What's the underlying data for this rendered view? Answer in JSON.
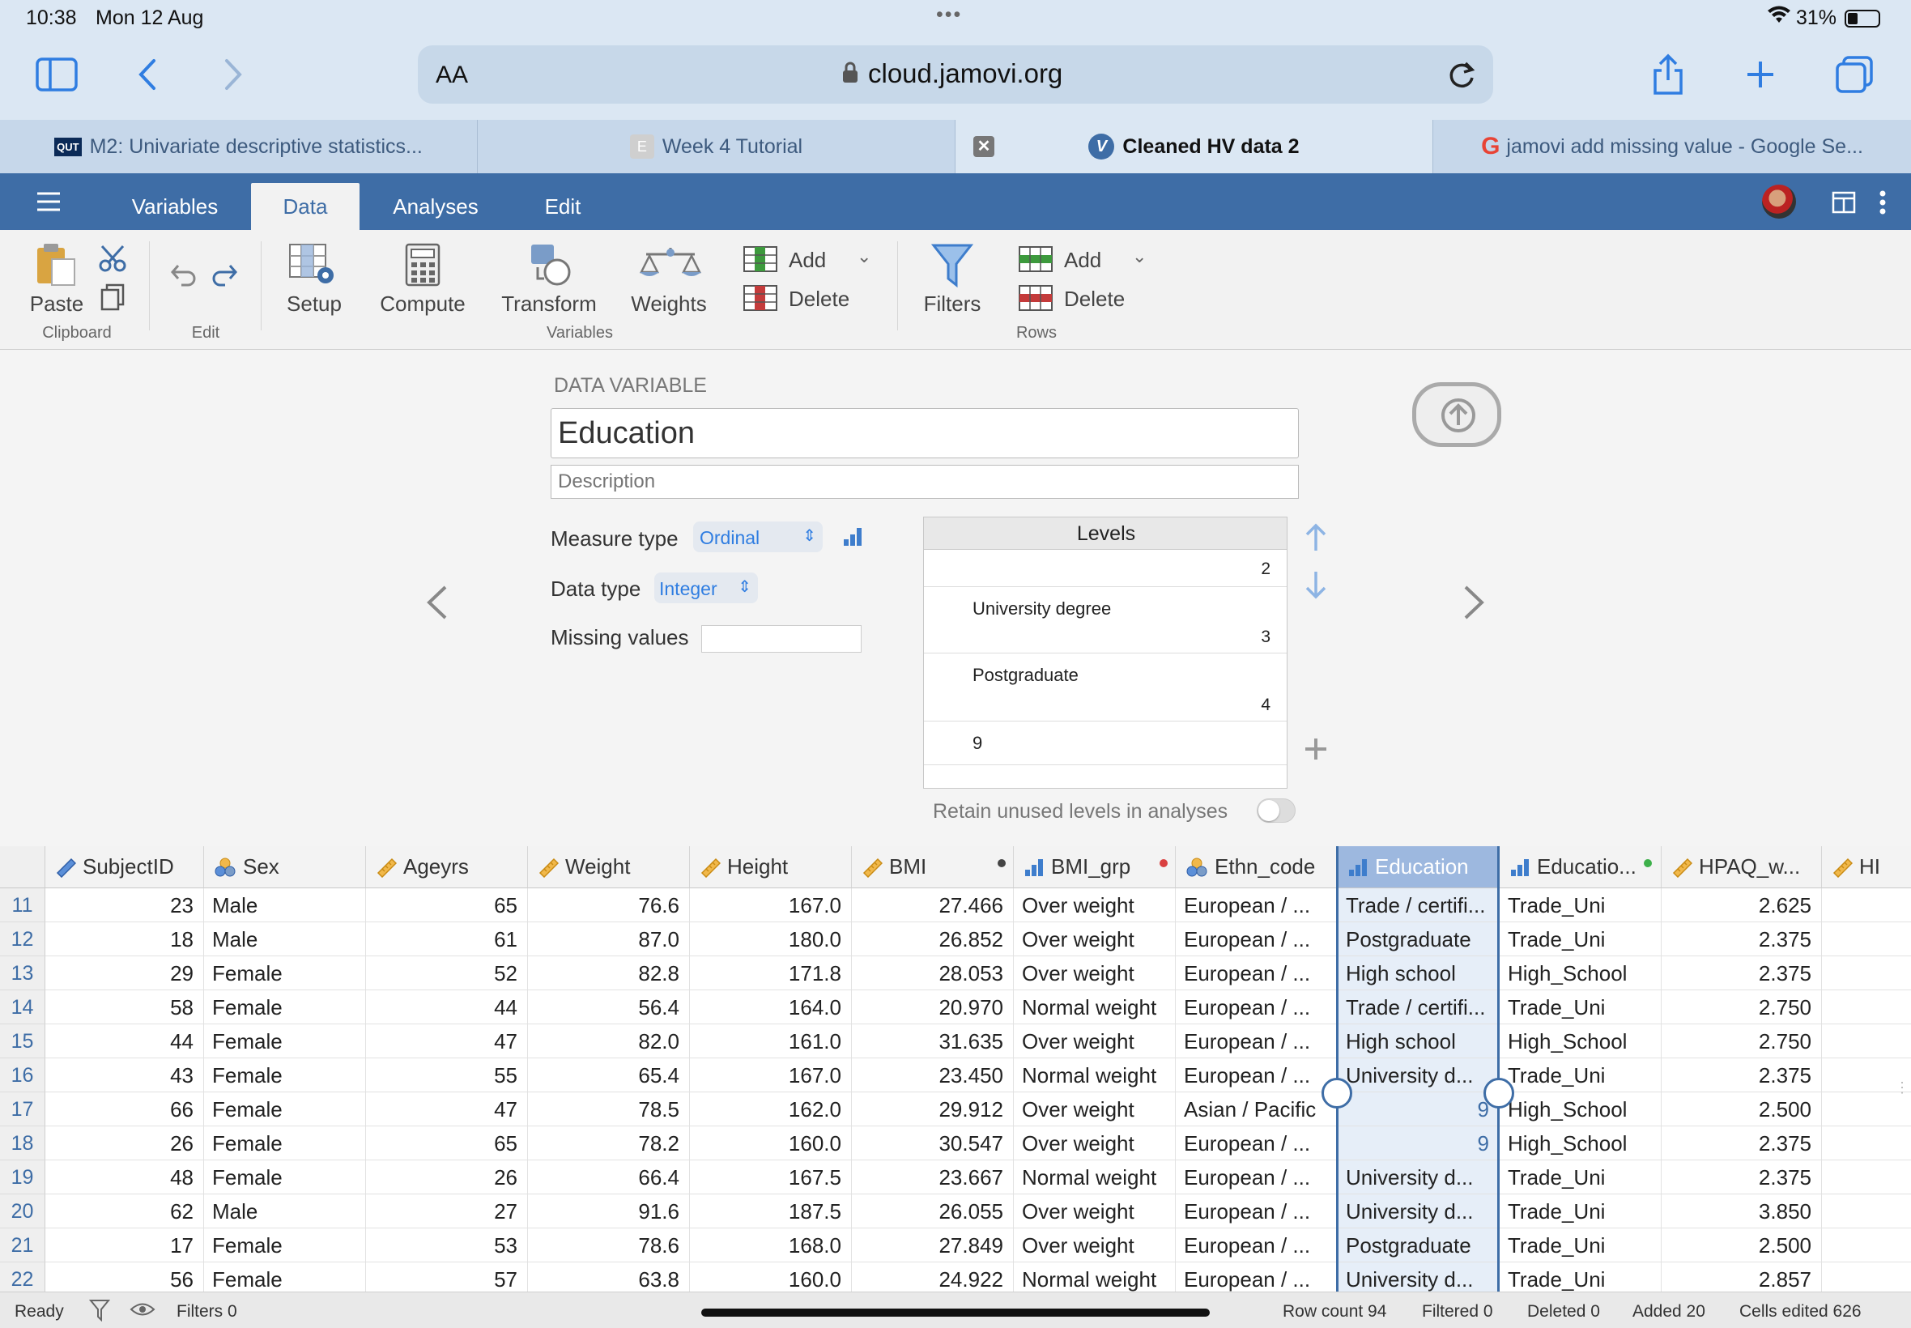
{
  "status": {
    "time": "10:38",
    "date": "Mon 12 Aug",
    "battery": "31%"
  },
  "browser": {
    "aa": "AA",
    "url": "cloud.jamovi.org",
    "tabs": [
      {
        "label": "M2: Univariate descriptive statistics...",
        "icon": "QUT"
      },
      {
        "label": "Week 4 Tutorial",
        "icon": "E"
      },
      {
        "label": "Cleaned HV data 2",
        "icon": "V"
      },
      {
        "label": "jamovi add missing value - Google Se...",
        "icon": "G"
      }
    ]
  },
  "menu": {
    "tabs": [
      "Variables",
      "Data",
      "Analyses",
      "Edit"
    ]
  },
  "ribbon": {
    "paste": "Paste",
    "clipboard": "Clipboard",
    "edit": "Edit",
    "setup": "Setup",
    "compute": "Compute",
    "transform": "Transform",
    "weights": "Weights",
    "add": "Add",
    "delete": "Delete",
    "variables": "Variables",
    "filters": "Filters",
    "rows": "Rows"
  },
  "setup": {
    "section_title": "DATA VARIABLE",
    "var_name": "Education",
    "description_placeholder": "Description",
    "measure_label": "Measure type",
    "measure_value": "Ordinal",
    "dtype_label": "Data type",
    "dtype_value": "Integer",
    "missing_label": "Missing values",
    "levels_header": "Levels",
    "levels": [
      {
        "label": "",
        "value": "2"
      },
      {
        "label": "University degree",
        "value": "3"
      },
      {
        "label": "Postgraduate",
        "value": "4"
      },
      {
        "label": "9",
        "value": ""
      }
    ],
    "retain_label": "Retain unused levels in analyses"
  },
  "grid": {
    "columns": [
      {
        "name": "SubjectID",
        "icon": "ruler-blue"
      },
      {
        "name": "Sex",
        "icon": "nominal"
      },
      {
        "name": "Ageyrs",
        "icon": "ruler"
      },
      {
        "name": "Weight",
        "icon": "ruler"
      },
      {
        "name": "Height",
        "icon": "ruler"
      },
      {
        "name": "BMI",
        "icon": "ruler"
      },
      {
        "name": "BMI_grp",
        "icon": "ordinal"
      },
      {
        "name": "Ethn_code",
        "icon": "nominal"
      },
      {
        "name": "Education",
        "icon": "ordinal"
      },
      {
        "name": "Educatio...",
        "icon": "ordinal"
      },
      {
        "name": "HPAQ_w...",
        "icon": "ruler"
      },
      {
        "name": "HI",
        "icon": "ruler"
      }
    ],
    "rows": [
      [
        "11",
        "23",
        "Male",
        "65",
        "76.6",
        "167.0",
        "27.466",
        "Over weight",
        "European / ...",
        "Trade / certifi...",
        "Trade_Uni",
        "2.625"
      ],
      [
        "12",
        "18",
        "Male",
        "61",
        "87.0",
        "180.0",
        "26.852",
        "Over weight",
        "European / ...",
        "Postgraduate",
        "Trade_Uni",
        "2.375"
      ],
      [
        "13",
        "29",
        "Female",
        "52",
        "82.8",
        "171.8",
        "28.053",
        "Over weight",
        "European / ...",
        "High school",
        "High_School",
        "2.375"
      ],
      [
        "14",
        "58",
        "Female",
        "44",
        "56.4",
        "164.0",
        "20.970",
        "Normal weight",
        "European / ...",
        "Trade / certifi...",
        "Trade_Uni",
        "2.750"
      ],
      [
        "15",
        "44",
        "Female",
        "47",
        "82.0",
        "161.0",
        "31.635",
        "Over weight",
        "European / ...",
        "High school",
        "High_School",
        "2.750"
      ],
      [
        "16",
        "43",
        "Female",
        "55",
        "65.4",
        "167.0",
        "23.450",
        "Normal weight",
        "European / ...",
        "University d...",
        "Trade_Uni",
        "2.375"
      ],
      [
        "17",
        "66",
        "Female",
        "47",
        "78.5",
        "162.0",
        "29.912",
        "Over weight",
        "Asian / Pacific",
        "9",
        "High_School",
        "2.500"
      ],
      [
        "18",
        "26",
        "Female",
        "65",
        "78.2",
        "160.0",
        "30.547",
        "Over weight",
        "European / ...",
        "9",
        "High_School",
        "2.375"
      ],
      [
        "19",
        "48",
        "Female",
        "26",
        "66.4",
        "167.5",
        "23.667",
        "Normal weight",
        "European / ...",
        "University d...",
        "Trade_Uni",
        "2.375"
      ],
      [
        "20",
        "62",
        "Male",
        "27",
        "91.6",
        "187.5",
        "26.055",
        "Over weight",
        "European / ...",
        "University d...",
        "Trade_Uni",
        "3.850"
      ],
      [
        "21",
        "17",
        "Female",
        "53",
        "78.6",
        "168.0",
        "27.849",
        "Over weight",
        "European / ...",
        "Postgraduate",
        "Trade_Uni",
        "2.500"
      ],
      [
        "22",
        "56",
        "Female",
        "57",
        "63.8",
        "160.0",
        "24.922",
        "Normal weight",
        "European / ...",
        "University d...",
        "Trade_Uni",
        "2.857"
      ]
    ]
  },
  "statusbar": {
    "ready": "Ready",
    "filters": "Filters 0",
    "row_count": "Row count 94",
    "filtered": "Filtered 0",
    "deleted": "Deleted 0",
    "added": "Added 20",
    "edited": "Cells edited 626"
  },
  "colors": {
    "jamovi_blue": "#3e6da6",
    "safari_bg": "#dbe7f3",
    "selected_col": "#e6eef8"
  }
}
